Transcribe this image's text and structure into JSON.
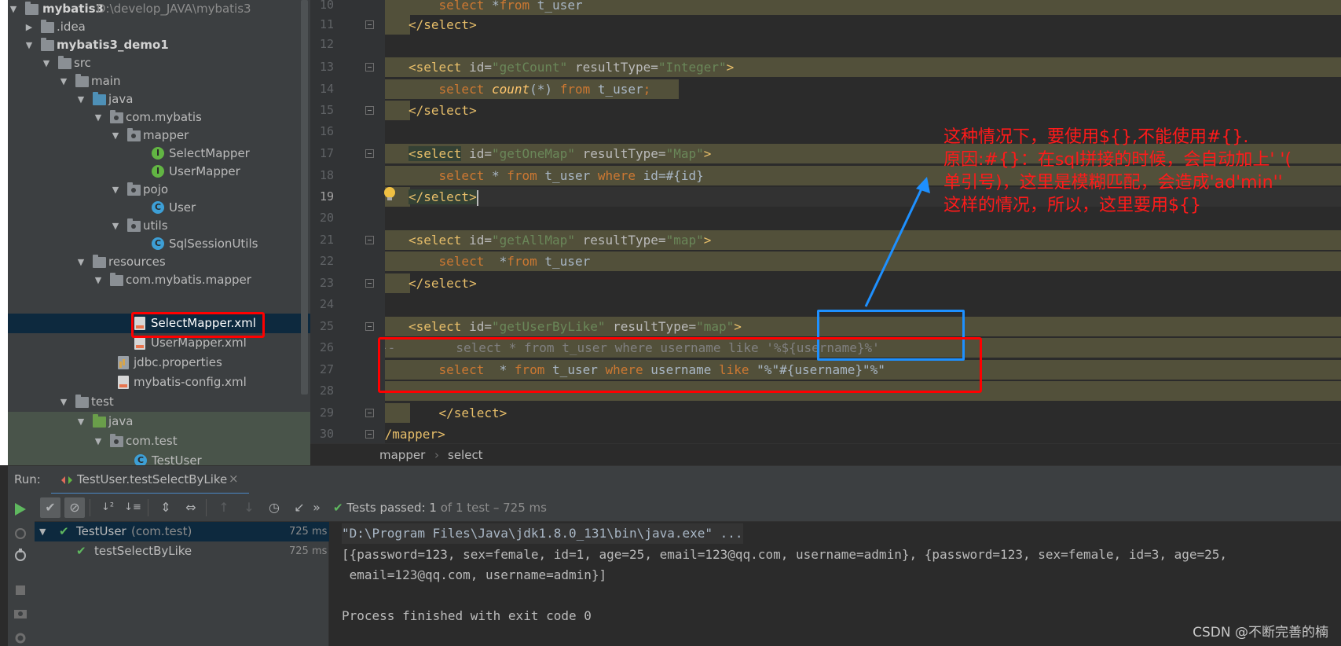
{
  "project_tree": {
    "items": [
      {
        "label": "mybatis3",
        "path": "D:\\develop_JAVA\\mybatis3"
      },
      {
        "label": ".idea"
      },
      {
        "label": "mybatis3_demo1"
      },
      {
        "label": "src"
      },
      {
        "label": "main"
      },
      {
        "label": "java"
      },
      {
        "label": "com.mybatis"
      },
      {
        "label": "mapper"
      },
      {
        "label": "SelectMapper"
      },
      {
        "label": "UserMapper"
      },
      {
        "label": "pojo"
      },
      {
        "label": "User"
      },
      {
        "label": "utils"
      },
      {
        "label": "SqlSessionUtils"
      },
      {
        "label": "resources"
      },
      {
        "label": "com.mybatis.mapper"
      },
      {
        "label": "SelectMapper.xml"
      },
      {
        "label": "UserMapper.xml"
      },
      {
        "label": "jdbc.properties"
      },
      {
        "label": "mybatis-config.xml"
      },
      {
        "label": "test"
      },
      {
        "label": "java"
      },
      {
        "label": "com.test"
      },
      {
        "label": "TestUser"
      }
    ]
  },
  "editor": {
    "line_numbers": [
      "10",
      "11",
      "12",
      "13",
      "14",
      "15",
      "16",
      "17",
      "18",
      "19",
      "20",
      "21",
      "22",
      "23",
      "24",
      "25",
      "26",
      "27",
      "28",
      "29",
      "30"
    ],
    "breadcrumb": [
      "mapper",
      "select"
    ]
  },
  "annotation": {
    "line1": "这种情况下，要使用${},不能使用#{}.",
    "line2": "原因:#{}：在sql拼接的时候，会自动加上' '(",
    "line3": "单引号)，这里是模糊匹配，会造成'ad'min''",
    "line4": "这样的情况，所以，这里要用${}"
  },
  "run": {
    "label": "Run:",
    "tab_label": "TestUser.testSelectByLike",
    "status_passed": "Tests passed:",
    "status_count": "1",
    "status_rest": "of 1 test – 725 ms",
    "tests": [
      {
        "name": "TestUser",
        "pkg": "(com.test)",
        "time": "725 ms"
      },
      {
        "name": "testSelectByLike",
        "time": "725 ms"
      }
    ],
    "console": [
      "\"D:\\Program Files\\Java\\jdk1.8.0_131\\bin\\java.exe\" ...",
      "[{password=123, sex=female, id=1, age=25, email=123@qq.com, username=admin}, {password=123, sex=female, id=3, age=25,",
      " email=123@qq.com, username=admin}]",
      "",
      "Process finished with exit code 0"
    ]
  },
  "watermark": "CSDN @不断完善的楠",
  "colors": {
    "tag": "#e8bf6a",
    "string": "#6a8759",
    "keyword": "#cc7832",
    "annotation_red": "#ff1a1a",
    "annotation_blue": "#1e90ff",
    "selected_bg": "#0d293e"
  },
  "icons": {
    "run_toolbar": [
      "rerun-icon",
      "show-passed-icon",
      "show-ignored-icon",
      "sort-alpha-icon",
      "sort-duration-icon",
      "expand-all-icon",
      "collapse-all-icon",
      "prev-failed-icon",
      "next-failed-icon",
      "history-icon",
      "export-icon"
    ]
  }
}
